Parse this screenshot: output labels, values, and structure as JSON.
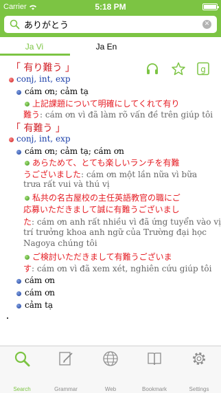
{
  "status_bar": {
    "carrier": "Carrier",
    "time": "5:18 PM"
  },
  "search": {
    "value": "ありがとう",
    "placeholder": ""
  },
  "tabs": [
    {
      "label": "Ja Vi",
      "active": true
    },
    {
      "label": "Ja En",
      "active": false
    }
  ],
  "entries": [
    {
      "headword": "「 有り難う 」",
      "pos": "conj, int, exp",
      "meanings": [
        {
          "meaning": "cám ơn; cảm tạ",
          "examples": [
            {
              "jp_lines": [
                "上記課題について明確にしてくれて有り",
                "難う"
              ],
              "vi_inline": ": cám ơn vì đã làm rõ vấn đề trên giúp tôi"
            }
          ]
        }
      ]
    },
    {
      "headword": "「 有難う 」",
      "pos": "conj, int, exp",
      "meanings": [
        {
          "meaning": "cám ơn; cảm tạ; cám ơn",
          "examples": [
            {
              "jp_lines": [
                "あらためて、とても楽しいランチを有難",
                "うございました"
              ],
              "vi_inline": ": cám ơn một lần nữa vì bữa",
              "vi_more": [
                "trưa rất vui và thú vị"
              ]
            },
            {
              "jp_lines": [
                "私共の名古屋校の主任英語教官の職にご",
                "応募いただきまして誠に有難うございまし",
                "た"
              ],
              "vi_inline": ": cám ơn anh rất nhiều vì đã ứng tuyển vào vị",
              "vi_more": [
                "trí trưởng khoa anh ngữ của Trường đại học",
                "Nagoya chúng tôi"
              ]
            },
            {
              "jp_lines": [
                "ご検討いただきまして有難うございま",
                "す"
              ],
              "vi_inline": ": cám ơn vì đã xem xét, nghiên cứu giúp tôi"
            }
          ]
        },
        {
          "meaning": "cám ơn"
        },
        {
          "meaning": "cám ơn"
        },
        {
          "meaning": "cảm tạ"
        }
      ]
    }
  ],
  "actions": [
    {
      "name": "headphones-icon"
    },
    {
      "name": "star-icon"
    },
    {
      "name": "google-icon"
    }
  ],
  "tabbar": [
    {
      "label": "Search",
      "icon": "search-icon",
      "active": true
    },
    {
      "label": "Grammar",
      "icon": "grammar-icon",
      "active": false
    },
    {
      "label": "Web",
      "icon": "globe-icon",
      "active": false
    },
    {
      "label": "Bookmark",
      "icon": "bookmark-icon",
      "active": false
    },
    {
      "label": "Settings",
      "icon": "gear-icon",
      "active": false
    }
  ],
  "colors": {
    "accent": "#7cc443",
    "headword": "#d2232a",
    "pos": "#1a3ea8",
    "example_jp": "#e51c23",
    "example_vi": "#666666"
  }
}
